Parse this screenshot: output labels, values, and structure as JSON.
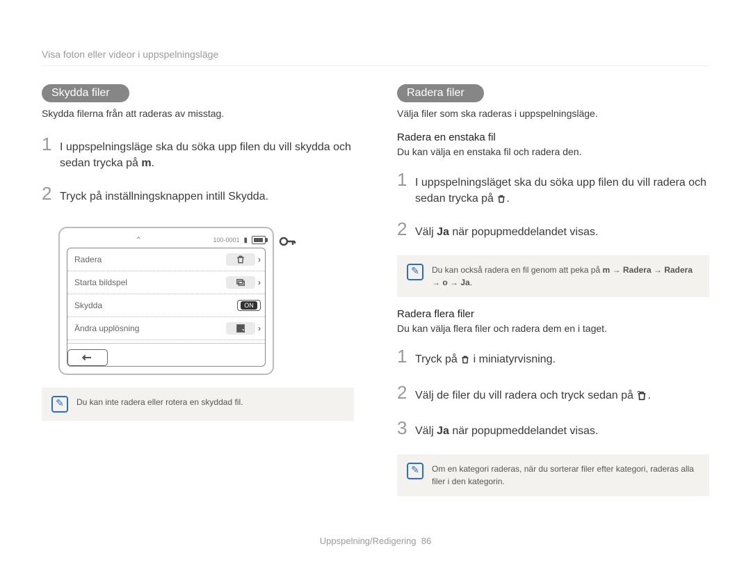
{
  "header": "Visa foton eller videor i uppspelningsläge",
  "left": {
    "pill": "Skydda ﬁler",
    "intro": "Skydda ﬁlerna från att raderas av misstag.",
    "steps": [
      "I uppspelningsläge ska du söka upp ﬁlen du vill skydda och sedan trycka på m.",
      "Tryck på inställningsknappen intill Skydda."
    ],
    "note": "Du kan inte radera eller rotera en skyddad ﬁl."
  },
  "right": {
    "pill": "Radera ﬁler",
    "intro": "Välja ﬁler som ska raderas i uppspelningsläge.",
    "single": {
      "head": "Radera en enstaka ﬁl",
      "desc": "Du kan välja en enstaka ﬁl och radera den.",
      "steps": [
        "I uppspelningsläget ska du söka upp ﬁlen du vill radera och sedan trycka på  .",
        "Välj Ja när popupmeddelandet visas."
      ],
      "note": "Du kan också radera en ﬁl genom att peka på m → Radera → Radera → o → Ja."
    },
    "multi": {
      "head": "Radera ﬂera ﬁler",
      "desc": "Du kan välja ﬂera ﬁler och radera dem en i taget.",
      "steps": [
        "Tryck på   i miniatyrvisning.",
        "Välj de ﬁler du vill radera och tryck sedan på   .",
        "Välj Ja när popupmeddelandet visas."
      ],
      "note": "Om en kategori raderas, när du sorterar ﬁler efter kategori, raderas alla ﬁler i den kategorin."
    }
  },
  "device": {
    "counter": "100-0001",
    "rows": [
      {
        "label": "Radera",
        "glyph": "trash"
      },
      {
        "label": "Starta bildspel",
        "glyph": "slideshow"
      },
      {
        "label": "Skydda",
        "glyph": "on"
      },
      {
        "label": "Ändra upplösning",
        "glyph": "resize"
      }
    ]
  },
  "footer": {
    "section": "Uppspelning/Redigering",
    "page": "86"
  }
}
